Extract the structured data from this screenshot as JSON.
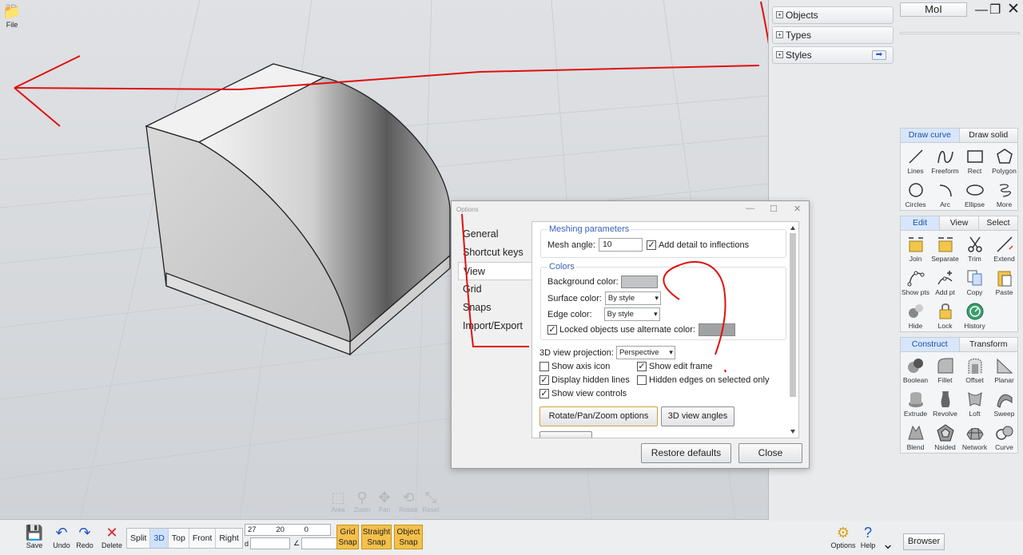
{
  "viewport": {
    "label": "3D"
  },
  "nav_controls": [
    {
      "name": "area",
      "label": "Area",
      "icon": "⬚"
    },
    {
      "name": "zoom",
      "label": "Zoom",
      "icon": "⚲"
    },
    {
      "name": "pan",
      "label": "Pan",
      "icon": "✥"
    },
    {
      "name": "rotate",
      "label": "Rotate",
      "icon": "⟲"
    },
    {
      "name": "reset",
      "label": "Reset",
      "icon": "⤡"
    }
  ],
  "scene_browser": {
    "items": [
      "Objects",
      "Types",
      "Styles"
    ]
  },
  "moi_title": "MoI",
  "draw_palette": {
    "tabs": [
      "Draw curve",
      "Draw solid"
    ],
    "tools": [
      "Lines",
      "Freeform",
      "Rect",
      "Polygon",
      "Circles",
      "Arc",
      "Ellipse",
      "More"
    ]
  },
  "edit_palette": {
    "tabs": [
      "Edit",
      "View",
      "Select"
    ],
    "tools": [
      "Join",
      "Separate",
      "Trim",
      "Extend",
      "Show pts",
      "Add pt",
      "Copy",
      "Paste",
      "Hide",
      "Lock",
      "History"
    ]
  },
  "construct_palette": {
    "tabs": [
      "Construct",
      "Transform"
    ],
    "tools": [
      "Boolean",
      "Fillet",
      "Offset",
      "Planar",
      "Extrude",
      "Revolve",
      "Loft",
      "Sweep",
      "Blend",
      "Nsided",
      "Network",
      "Curve"
    ]
  },
  "bottombar": {
    "file": "File",
    "save": "Save",
    "undo": "Undo",
    "redo": "Redo",
    "delete": "Delete",
    "views": [
      "Split",
      "3D",
      "Top",
      "Front",
      "Right"
    ],
    "coords": [
      "27",
      "20",
      "0"
    ],
    "d_label": "d",
    "angle_label": "∠",
    "snaps": [
      [
        "Grid",
        "Snap"
      ],
      [
        "Straight",
        "Snap"
      ],
      [
        "Object",
        "Snap"
      ]
    ],
    "options": "Options",
    "help": "Help",
    "browser": "Browser"
  },
  "dialog": {
    "title": "Options",
    "nav": [
      "General",
      "Shortcut keys",
      "View",
      "Grid",
      "Snaps",
      "Import/Export"
    ],
    "meshing": {
      "title": "Meshing parameters",
      "mesh_angle_label": "Mesh angle:",
      "mesh_angle_value": "10",
      "detail_label": "Add detail to inflections"
    },
    "colors": {
      "title": "Colors",
      "background_label": "Background color:",
      "surface_label": "Surface color:",
      "surface_value": "By style",
      "edge_label": "Edge color:",
      "edge_value": "By style",
      "locked_label": "Locked objects use alternate color:"
    },
    "projection_label": "3D view projection:",
    "projection_value": "Perspective",
    "show_axis": "Show axis icon",
    "show_edit_frame": "Show edit frame",
    "display_hidden": "Display hidden lines",
    "hidden_edges": "Hidden edges on selected only",
    "show_view_controls": "Show view controls",
    "rotate_btn": "Rotate/Pan/Zoom options",
    "angles_btn": "3D view angles",
    "restore_btn": "Restore defaults",
    "close_btn": "Close"
  },
  "colors": {
    "accent": "#2356c5",
    "snap": "#f5c04a",
    "annotation": "#e01010"
  }
}
